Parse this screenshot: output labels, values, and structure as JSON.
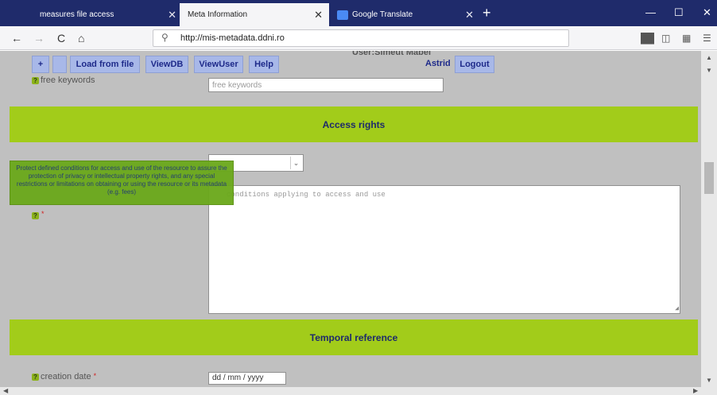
{
  "browser": {
    "tabs": [
      {
        "title": "measures file access"
      },
      {
        "title": "Meta Information"
      },
      {
        "title": "Google Translate"
      }
    ],
    "url": "http://mis-metadata.ddni.ro",
    "icons": {
      "back": "←",
      "forward": "→",
      "reload": "C",
      "home": "⌂",
      "new_tab": "+",
      "close_tab": "✕"
    }
  },
  "toolbar": {
    "buttons": [
      "+",
      "",
      "Load from file",
      "ViewDB",
      "ViewUser",
      "Help"
    ],
    "session_info": "User:Simeut Mabel",
    "username": "Astrid",
    "logout_label": "Logout"
  },
  "form": {
    "free_keywords_label": "free keywords",
    "free_keywords_placeholder": "free keywords",
    "access_rights_header": "Access rights",
    "conditions_placeholder": "conditions applying to access and use",
    "tooltip_text": "Protect defined conditions for access and use of the resource to assure the protection of privacy or intellectual property rights, and any special restrictions or limitations on obtaining or using the resource or its metadata (e.g. fees)",
    "temporal_header": "Temporal reference",
    "creation_date_label": "creation date",
    "creation_date_placeholder": "dd / mm / yyyy"
  }
}
